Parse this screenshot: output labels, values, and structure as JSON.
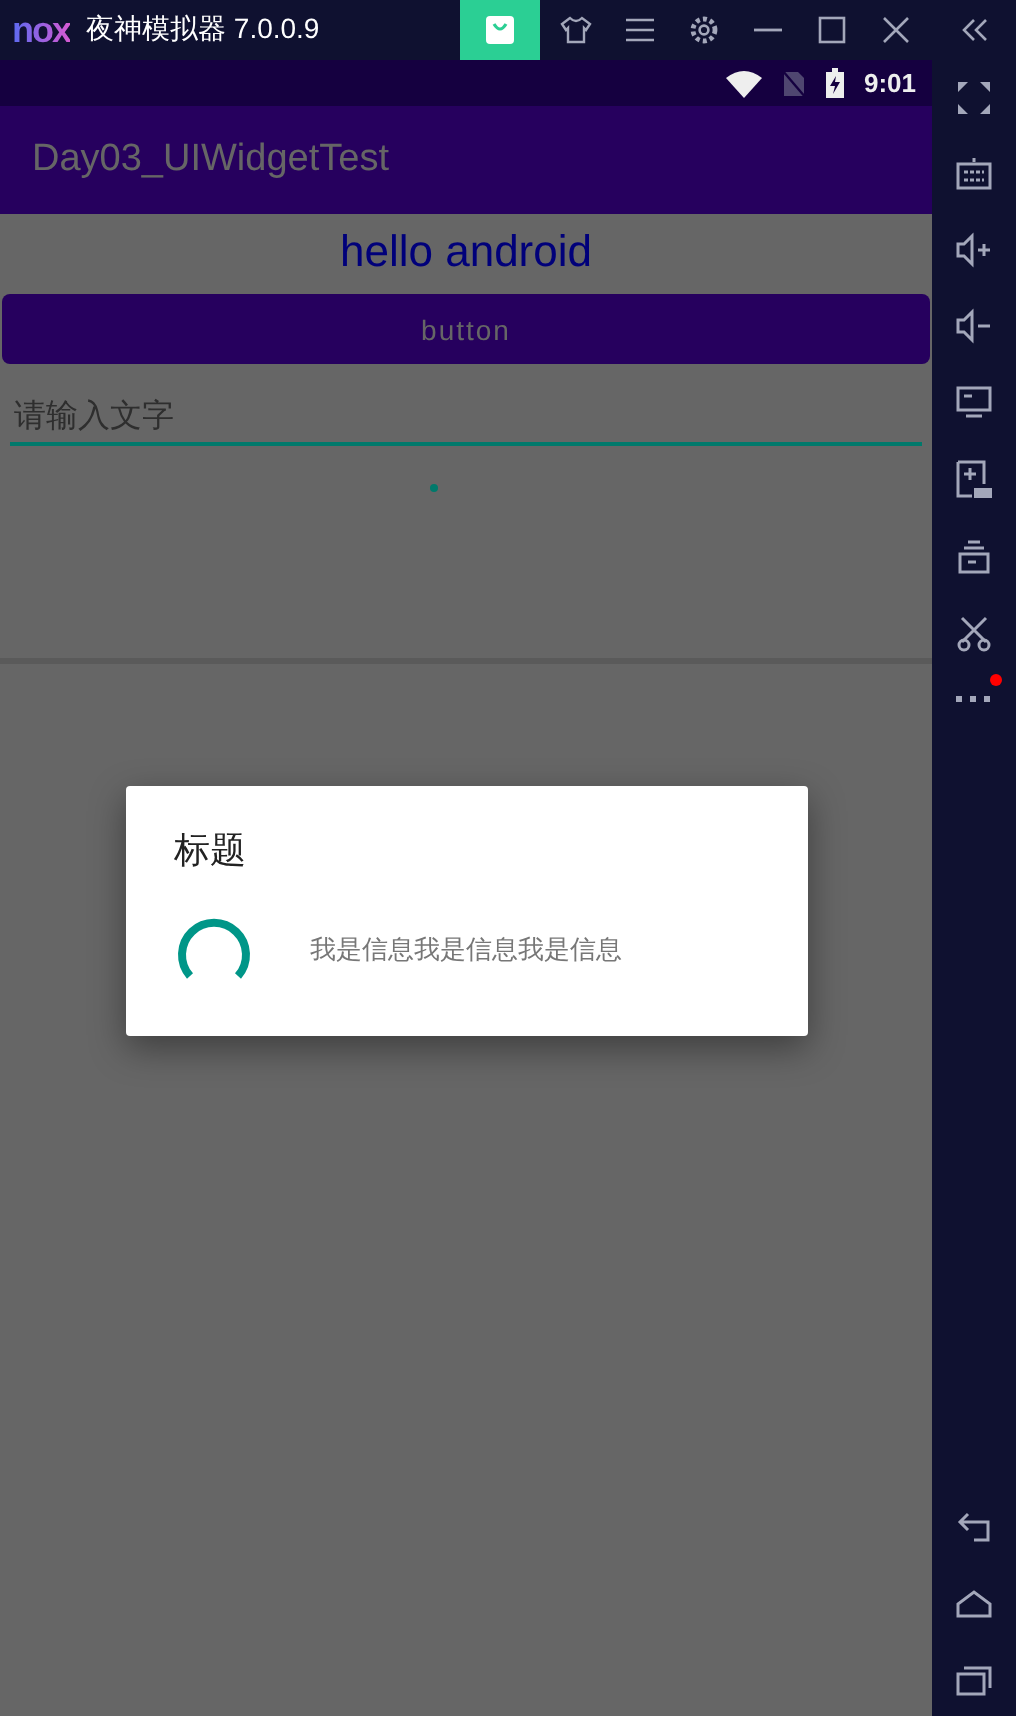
{
  "window": {
    "logo": "nox",
    "title": "夜神模拟器 7.0.0.9"
  },
  "status_bar": {
    "time": "9:01"
  },
  "app_bar": {
    "title": "Day03_UIWidgetTest"
  },
  "content": {
    "heading": "hello android",
    "button": "button",
    "input": {
      "placeholder": "请输入文字"
    }
  },
  "dialog": {
    "title": "标题",
    "message": "我是信息我是信息我是信息"
  },
  "sidebar": {
    "more_badge": true
  }
}
